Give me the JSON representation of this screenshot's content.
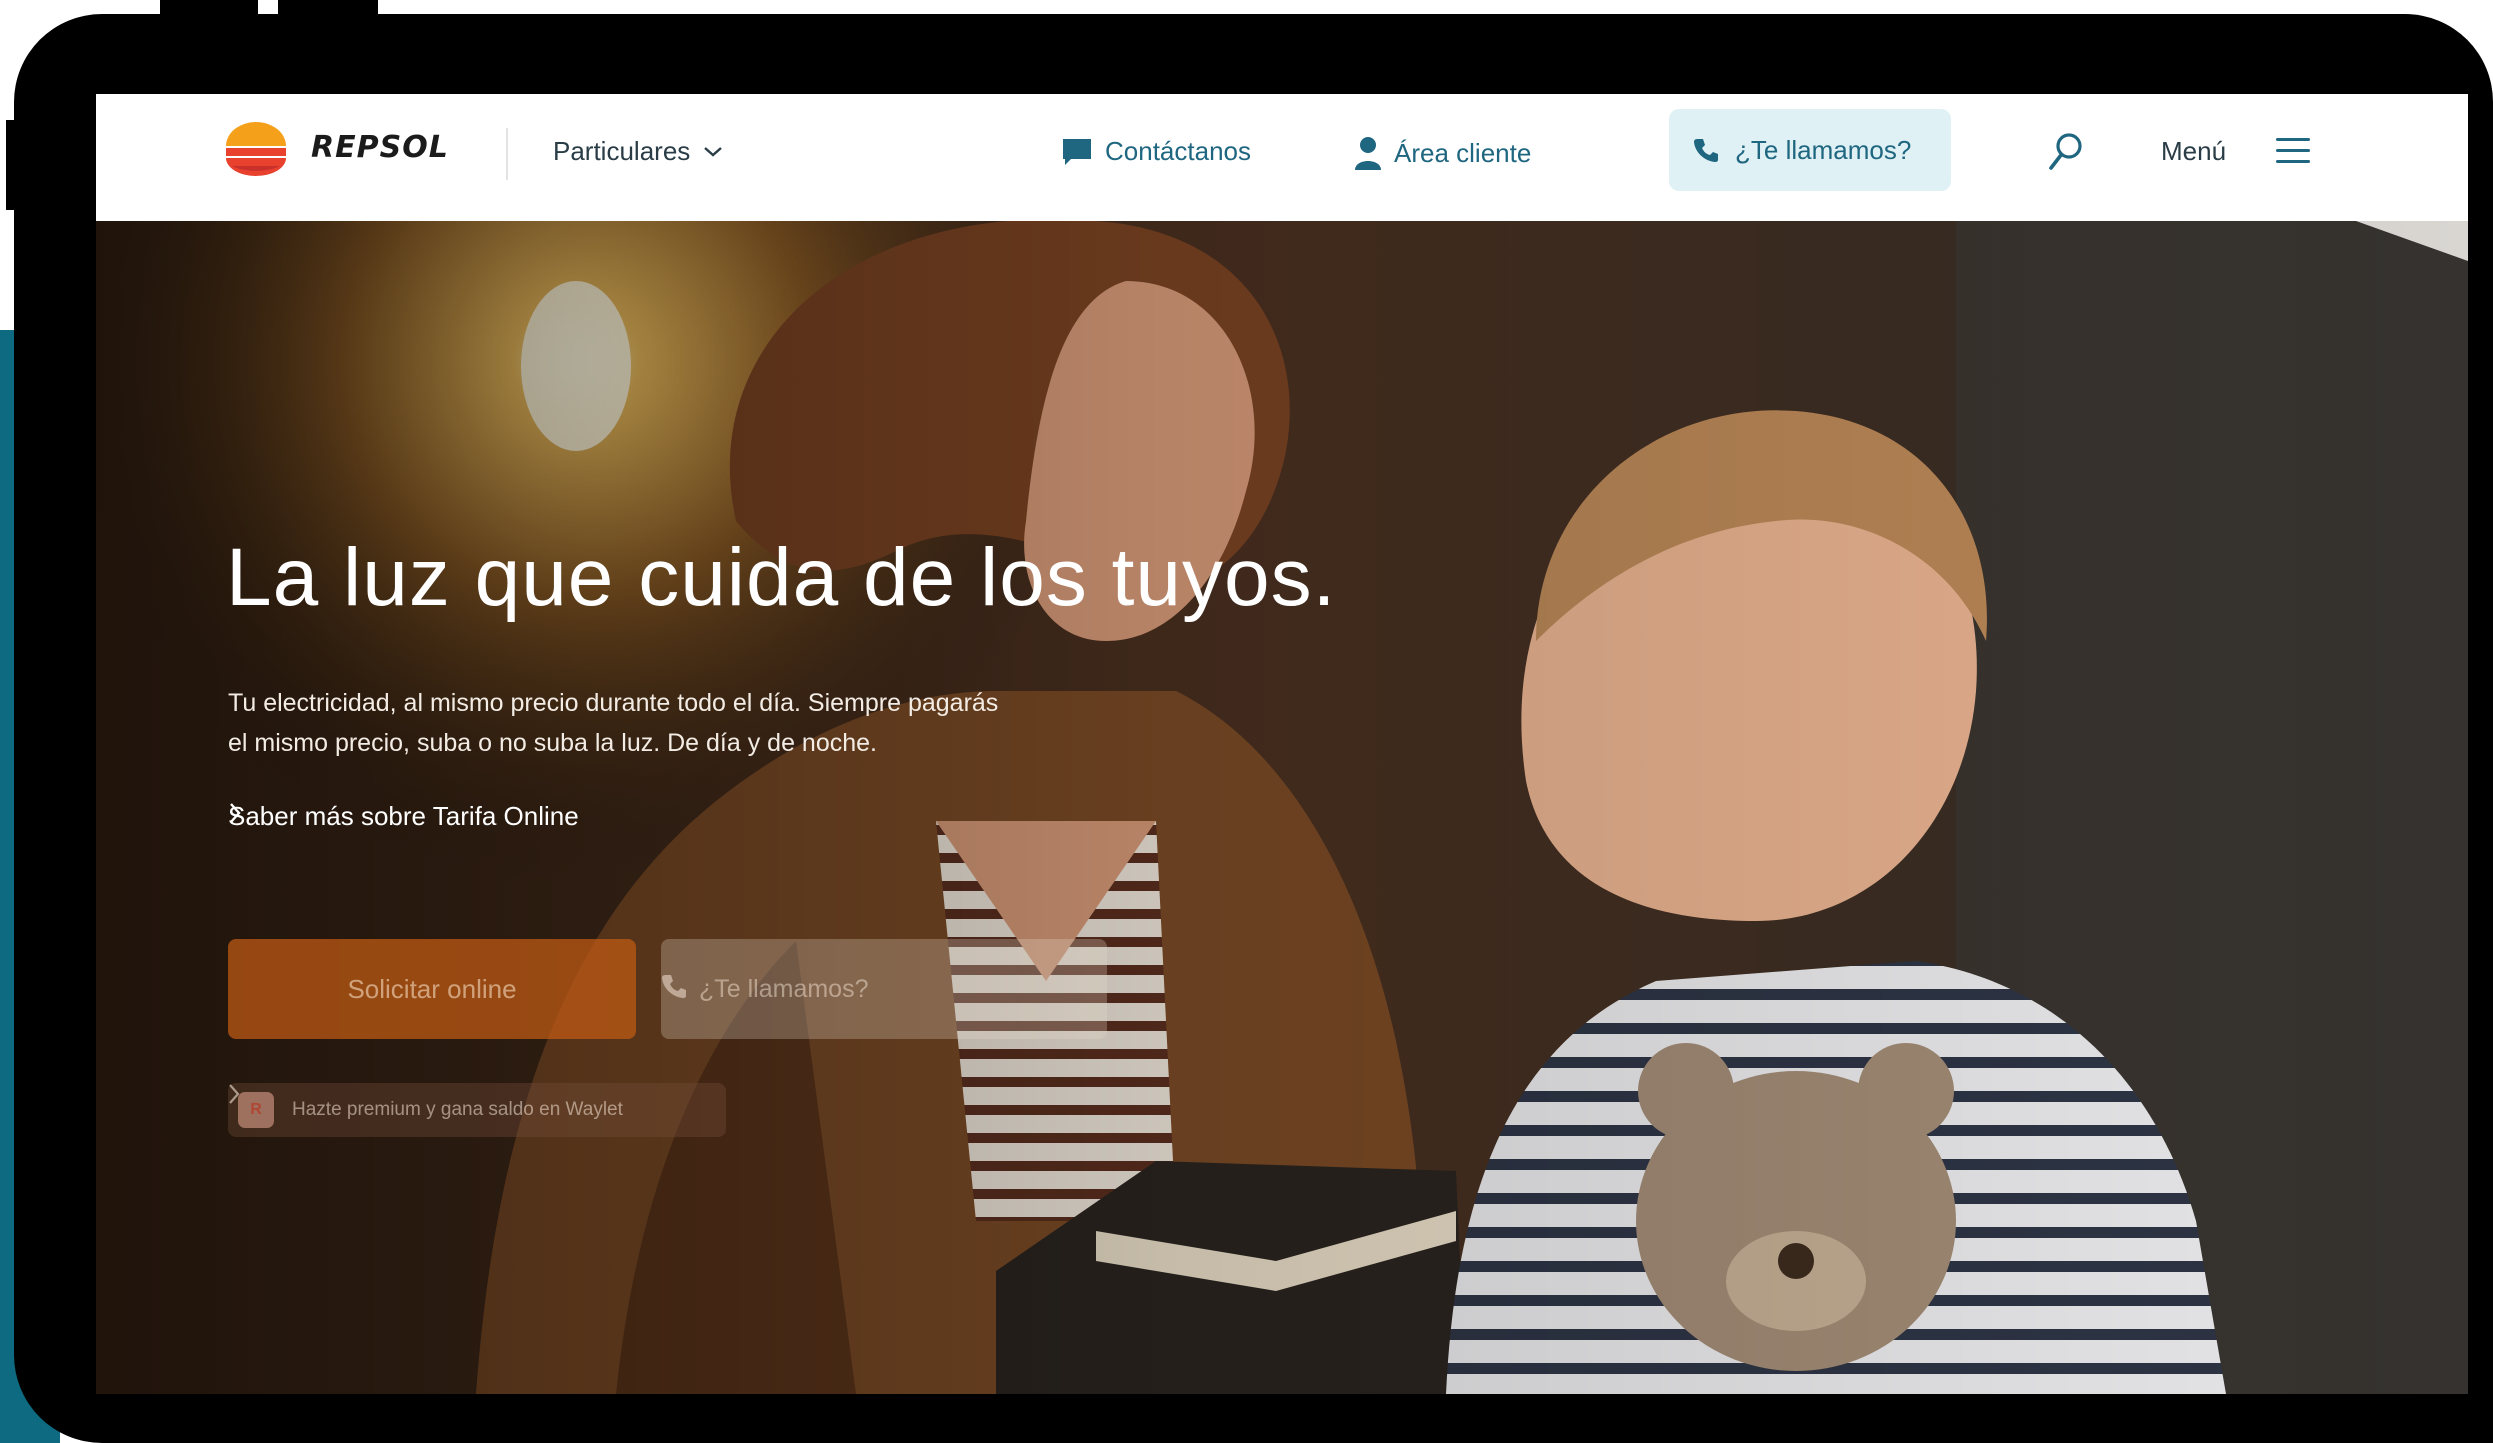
{
  "header": {
    "brand": "REPSOL",
    "segment": "Particulares",
    "contact": "Contáctanos",
    "client_area": "Área cliente",
    "callme": "¿Te llamamos?",
    "menu": "Menú"
  },
  "hero": {
    "headline": "La luz que cuida de los tuyos.",
    "lead_line1": "Tu electricidad, al mismo precio durante todo el día. Siempre pagarás",
    "lead_line2": "el mismo precio, suba o no suba la luz. De día y de noche.",
    "more_link": "Saber más sobre Tarifa Online",
    "cta_primary": "Solicitar online",
    "cta_secondary": "¿Te llamamos?",
    "promo_badge": "R",
    "promo": "Hazte premium y gana saldo en Waylet"
  },
  "colors": {
    "accent": "#1f6680",
    "callme_bg": "#dff1f5",
    "cta_orange": "#be5a14",
    "frame": "#000000",
    "teal_side": "#0e6a80"
  },
  "icons": [
    "chevron-down-icon",
    "chat-icon",
    "user-icon",
    "phone-icon",
    "search-icon",
    "hamburger-icon",
    "chevron-right-icon"
  ]
}
